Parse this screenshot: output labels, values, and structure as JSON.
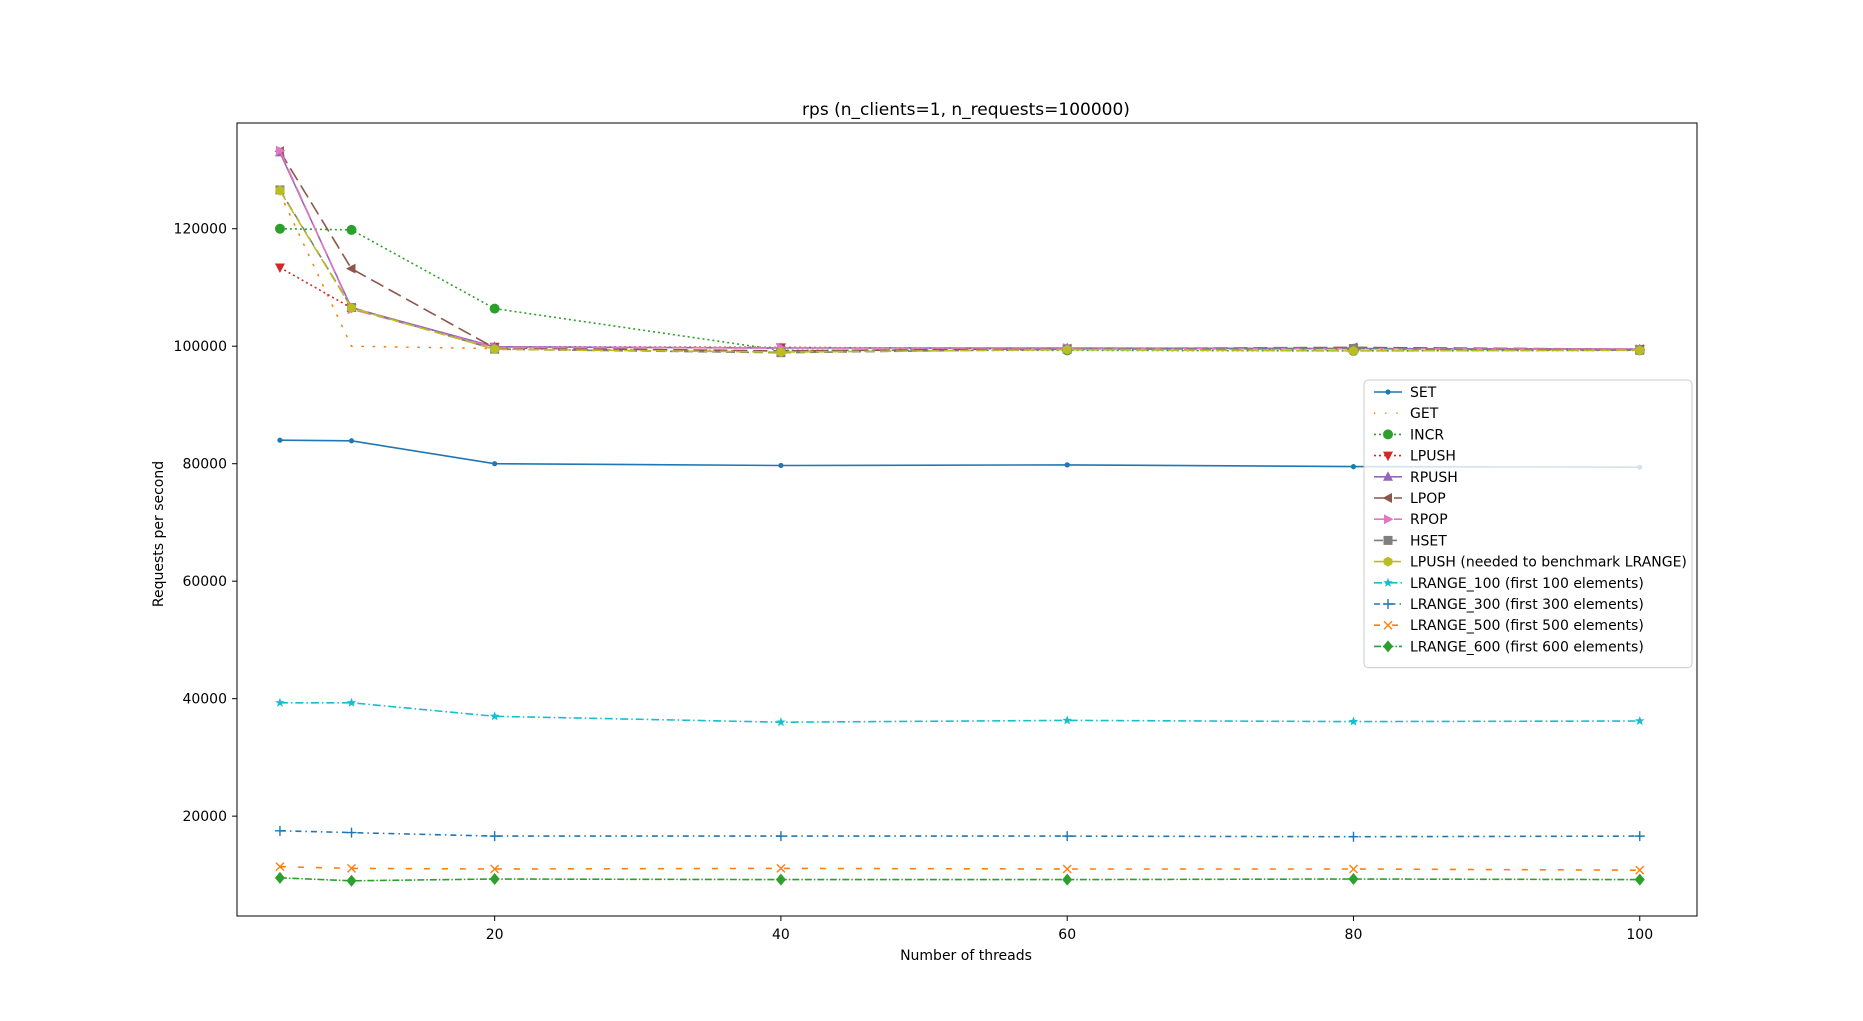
{
  "chart_data": {
    "type": "line",
    "title": "rps (n_clients=1, n_requests=100000)",
    "xlabel": "Number of threads",
    "ylabel": "Requests per second",
    "xlim": [
      2,
      104
    ],
    "ylim": [
      3000,
      138000
    ],
    "xticks": [
      20,
      40,
      60,
      80,
      100
    ],
    "yticks": [
      20000,
      40000,
      60000,
      80000,
      100000,
      120000
    ],
    "grid": false,
    "legend_position": "center-right",
    "x": [
      5,
      10,
      20,
      40,
      60,
      80,
      100
    ],
    "series": [
      {
        "name": "SET",
        "values": [
          84000,
          83900,
          80000,
          79700,
          79800,
          79500,
          79400
        ],
        "color": "#1f77b4",
        "dash": "",
        "marker": "point"
      },
      {
        "name": "GET",
        "values": [
          126000,
          100000,
          99600,
          99200,
          99700,
          99400,
          99300
        ],
        "color": "#ff7f0e",
        "dash": "1.2,10",
        "marker": "none"
      },
      {
        "name": "INCR",
        "values": [
          120000,
          119800,
          106400,
          99300,
          99300,
          99200,
          99300
        ],
        "color": "#2ca02c",
        "dash": "2,3",
        "marker": "circle"
      },
      {
        "name": "LPUSH",
        "values": [
          113400,
          106500,
          99900,
          99800,
          99600,
          99600,
          99500
        ],
        "color": "#d62728",
        "dash": "2,3",
        "marker": "triangle-down"
      },
      {
        "name": "RPUSH",
        "values": [
          133000,
          106500,
          99900,
          99700,
          99700,
          99600,
          99500
        ],
        "color": "#9467bd",
        "dash": "",
        "marker": "triangle-up"
      },
      {
        "name": "LPOP",
        "values": [
          133200,
          113200,
          99700,
          99200,
          99600,
          99800,
          99500
        ],
        "color": "#8c564b",
        "dash": "14,6",
        "marker": "triangle-left"
      },
      {
        "name": "RPOP",
        "values": [
          133300,
          106300,
          99800,
          99700,
          99700,
          99600,
          99500
        ],
        "color": "#e377c2",
        "dash": "14,6",
        "marker": "triangle-right"
      },
      {
        "name": "HSET",
        "values": [
          126600,
          106600,
          99500,
          98900,
          99500,
          99600,
          99300
        ],
        "color": "#7f7f7f",
        "dash": "9,5",
        "marker": "square"
      },
      {
        "name": "LPUSH (needed to benchmark LRANGE)",
        "values": [
          126500,
          106500,
          99500,
          99000,
          99400,
          99200,
          99300
        ],
        "color": "#bcbd22",
        "dash": "11,5",
        "marker": "hexagon"
      },
      {
        "name": "LRANGE_100 (first 100 elements)",
        "values": [
          39300,
          39300,
          37000,
          36000,
          36300,
          36100,
          36200
        ],
        "color": "#17becf",
        "dash": "8,3,1.5,3",
        "marker": "star"
      },
      {
        "name": "LRANGE_300 (first 300 elements)",
        "values": [
          17500,
          17200,
          16600,
          16600,
          16600,
          16500,
          16600
        ],
        "color": "#1f77b4",
        "dash": "6,4,1.5,4",
        "marker": "plus"
      },
      {
        "name": "LRANGE_500 (first 500 elements)",
        "values": [
          11400,
          11100,
          11000,
          11100,
          11000,
          11000,
          10800
        ],
        "color": "#ff7f0e",
        "dash": "6,12",
        "marker": "x"
      },
      {
        "name": "LRANGE_600 (first 600 elements)",
        "values": [
          9500,
          9000,
          9300,
          9200,
          9200,
          9300,
          9200
        ],
        "color": "#2ca02c",
        "dash": "7,2,1.5,2",
        "marker": "diamond"
      }
    ]
  }
}
